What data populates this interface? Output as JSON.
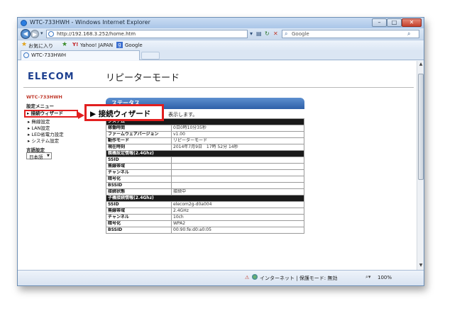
{
  "window": {
    "title": "WTC-733HWH - Windows Internet Explorer",
    "min": "–",
    "max": "□",
    "close": "✕"
  },
  "addressbar": {
    "back": "◀",
    "forward": "▶",
    "url": "http://192.168.3.252/home.htm",
    "search_placeholder": "Google"
  },
  "favorites": {
    "label": "お気に入り",
    "items": [
      "Yahoo! JAPAN",
      "Google"
    ]
  },
  "tab": {
    "title": "WTC-733HWH"
  },
  "header": {
    "logo": "ELECOM",
    "mode": "リピーターモード"
  },
  "sidebar": {
    "device": "WTC-733HWH",
    "heading": "設定メニュー",
    "items": [
      "接続ウィザード",
      "無線設定",
      "LAN設定",
      "LED省電力設定",
      "システム設定"
    ],
    "lang_label": "言語設定",
    "lang_value": "日本語"
  },
  "callout": {
    "text": "▶ 接続ウィザード"
  },
  "main": {
    "tab_label": "ステータス",
    "desc": "表示します。",
    "system_header": "システム",
    "system_rows": [
      {
        "label": "稼働時間",
        "value": "0日0時10分35秒"
      },
      {
        "label": "ファームウェアバージョン",
        "value": "v1.00"
      },
      {
        "label": "動作モード",
        "value": "リピーターモード"
      },
      {
        "label": "現在時刻",
        "value": "2014年7月9日　17時 52分 14秒"
      }
    ],
    "parent_header": "親機設定情報(2.4Ghz)",
    "parent_rows": [
      {
        "label": "SSID",
        "value": ""
      },
      {
        "label": "無線帯域",
        "value": ""
      },
      {
        "label": "チャンネル",
        "value": ""
      },
      {
        "label": "暗号化",
        "value": ""
      },
      {
        "label": "BSSID",
        "value": ""
      },
      {
        "label": "接続状態",
        "value": "接続中"
      }
    ],
    "child_header": "子機接続情報(2.4Ghz)",
    "child_rows": [
      {
        "label": "SSID",
        "value": "elecom2g-d0a004"
      },
      {
        "label": "無線帯域",
        "value": "2.4GHz"
      },
      {
        "label": "チャンネル",
        "value": "10ch"
      },
      {
        "label": "暗号化",
        "value": "WPA2"
      },
      {
        "label": "BSSID",
        "value": "00:90:fe:d0:a0:05"
      }
    ]
  },
  "statusbar": {
    "zone": "インターネット | 保護モード: 無効",
    "zoom": "100%"
  },
  "colors": {
    "accent_red": "#e21f1f",
    "brand_blue": "#1d3f8f",
    "tab_blue": "#2e5fa8"
  }
}
